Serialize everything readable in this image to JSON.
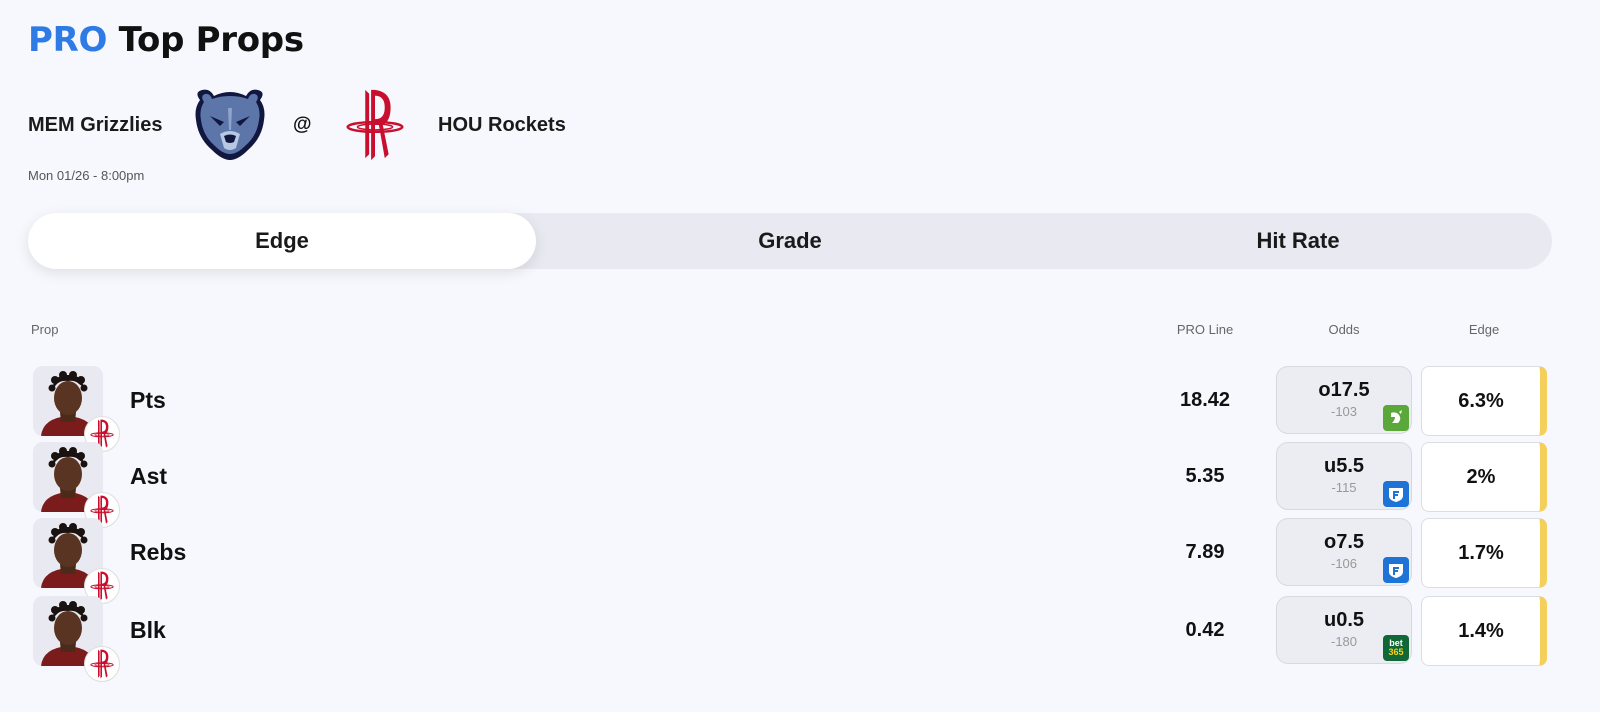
{
  "header": {
    "title_pro": "PRO",
    "title_rest": "Top Props"
  },
  "matchup": {
    "away_team": "MEM Grizzlies",
    "away_logo": "grizzlies-logo",
    "separator": "@",
    "home_team": "HOU Rockets",
    "home_logo": "rockets-logo",
    "datetime": "Mon 01/26 - 8:00pm"
  },
  "tabs": [
    {
      "label": "Edge",
      "active": true
    },
    {
      "label": "Grade",
      "active": false
    },
    {
      "label": "Hit Rate",
      "active": false
    }
  ],
  "table": {
    "headers": {
      "prop": "Prop",
      "pro_line": "PRO Line",
      "odds": "Odds",
      "edge": "Edge"
    },
    "rows": [
      {
        "prop": "Pts",
        "pro_line": "18.42",
        "odds_line": "o17.5",
        "odds_price": "-103",
        "book": "draftkings",
        "edge": "6.3%"
      },
      {
        "prop": "Ast",
        "pro_line": "5.35",
        "odds_line": "u5.5",
        "odds_price": "-115",
        "book": "fanduel",
        "edge": "2%"
      },
      {
        "prop": "Rebs",
        "pro_line": "7.89",
        "odds_line": "o7.5",
        "odds_price": "-106",
        "book": "fanduel",
        "edge": "1.7%"
      },
      {
        "prop": "Blk",
        "pro_line": "0.42",
        "odds_line": "u0.5",
        "odds_price": "-180",
        "book": "bet365",
        "edge": "1.4%"
      }
    ]
  },
  "books": {
    "bet365_top": "bet",
    "bet365_bottom": "365"
  },
  "colors": {
    "accent": "#2f7be5",
    "edge_bar": "#f4cf5a",
    "rockets_red": "#c8102e",
    "grizzlies_navy": "#12173f",
    "grizzlies_blue": "#5d76a9",
    "draftkings": "#5aa83a",
    "fanduel": "#1e74d6",
    "bet365": "#116836"
  },
  "icons": {
    "player": "player-headshot-icon",
    "team_badge": "rockets-badge-icon"
  }
}
